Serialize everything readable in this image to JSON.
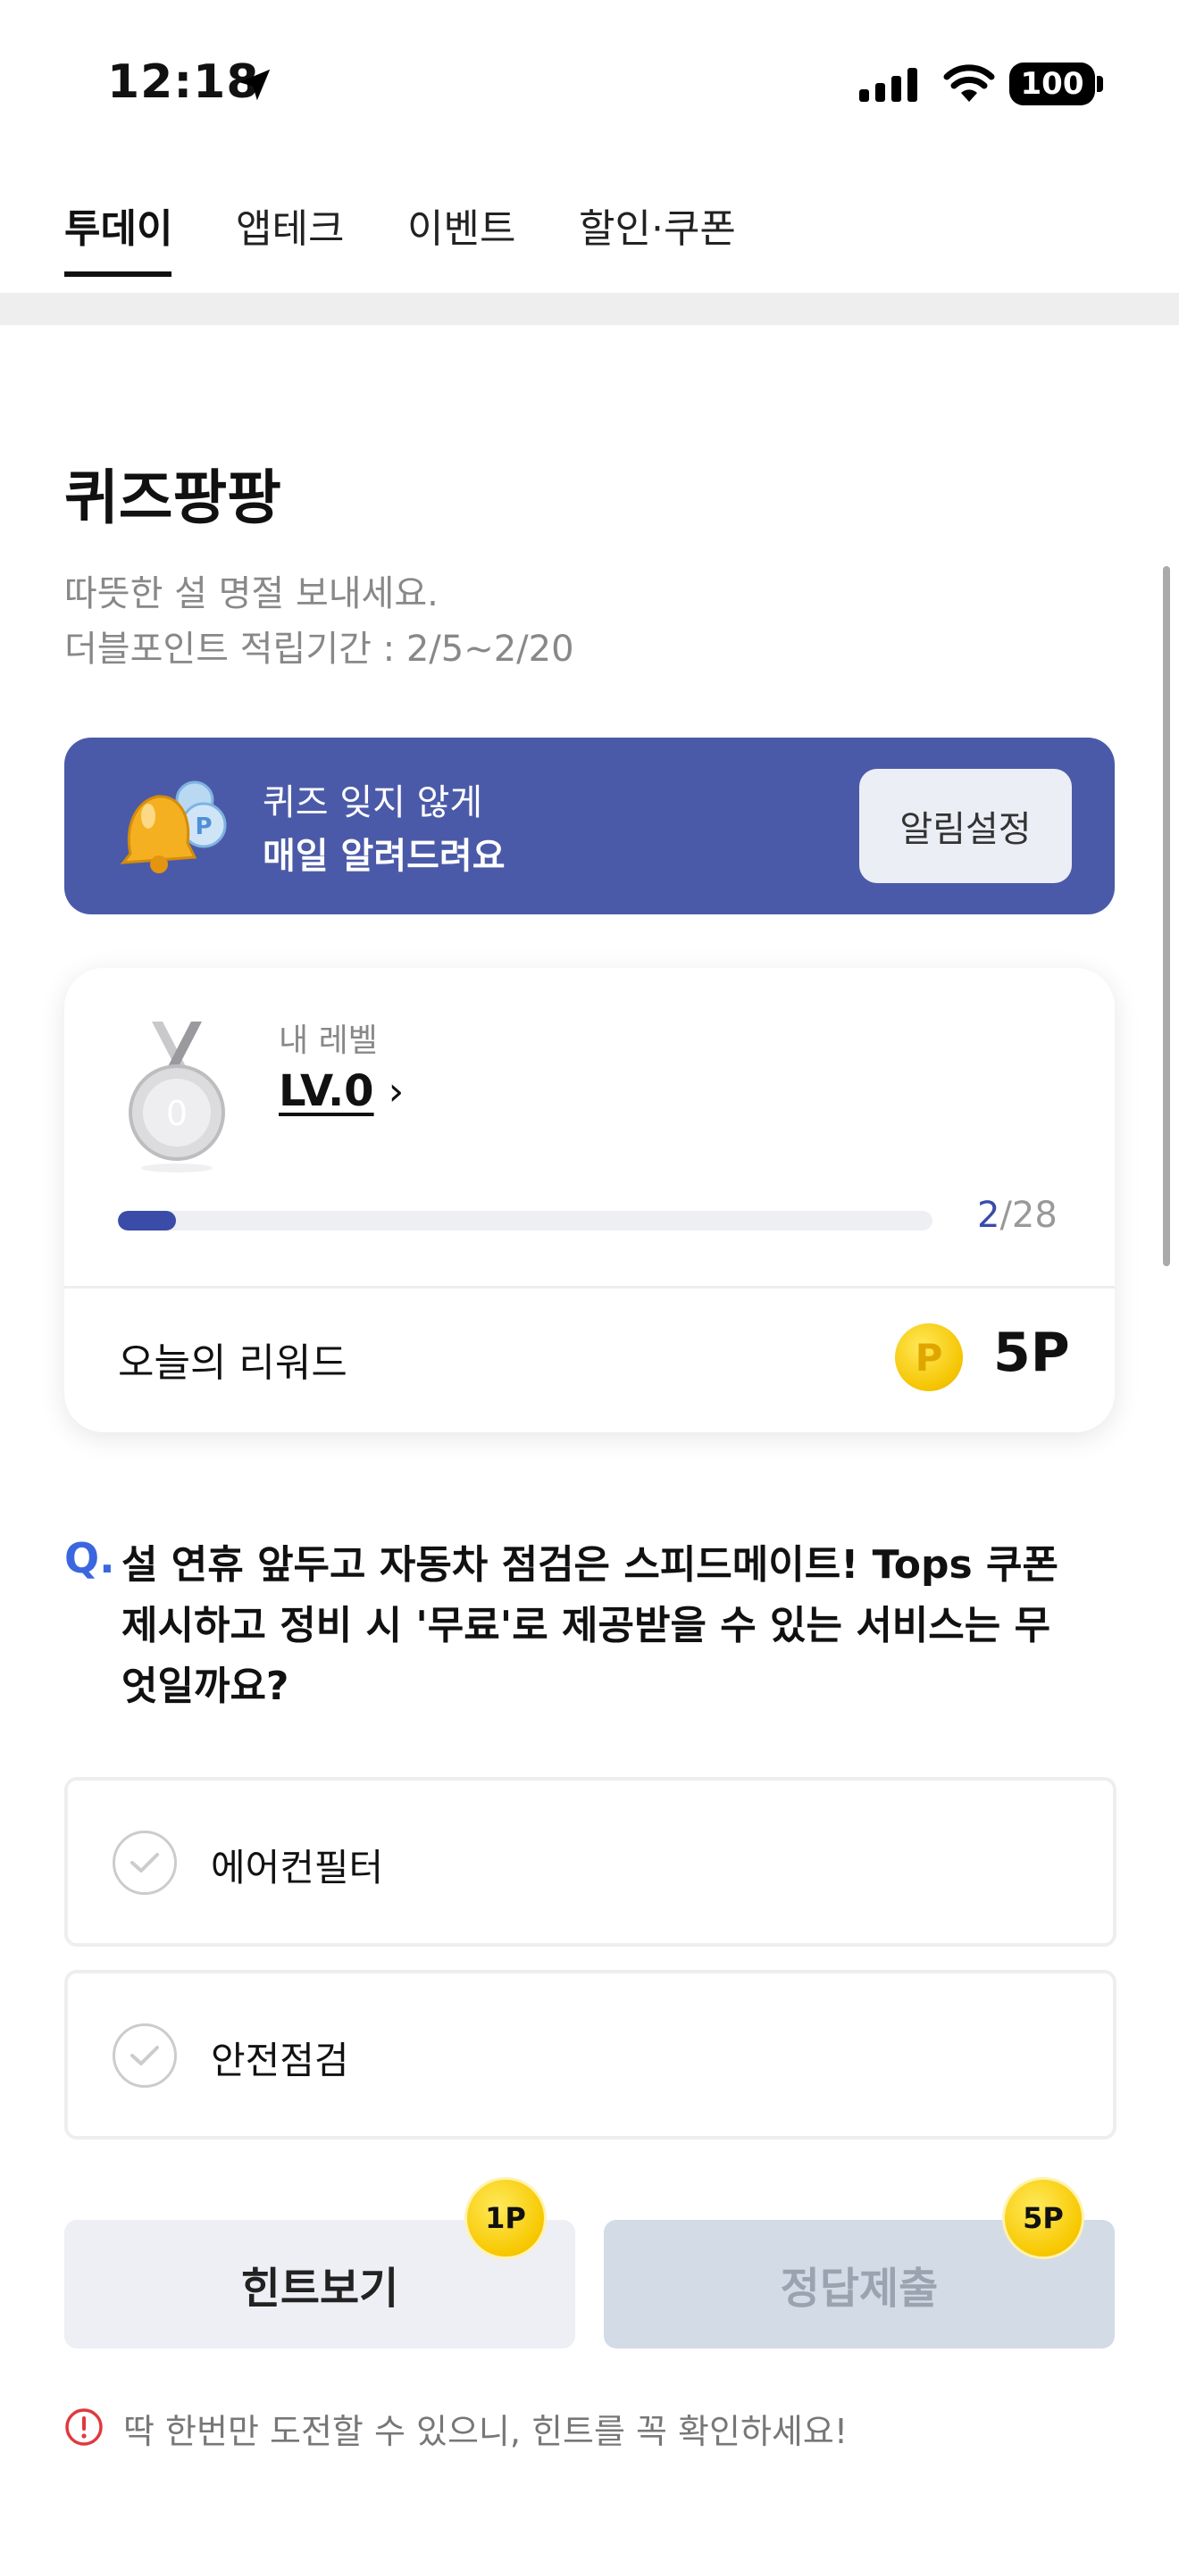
{
  "status_bar": {
    "time": "12:18",
    "battery": "100"
  },
  "tabs": [
    {
      "label": "투데이",
      "active": true
    },
    {
      "label": "앱테크",
      "active": false
    },
    {
      "label": "이벤트",
      "active": false
    },
    {
      "label": "할인·쿠폰",
      "active": false
    }
  ],
  "quiz": {
    "title": "퀴즈팡팡",
    "subtitle_lines": [
      "따뜻한 설 명절 보내세요.",
      "더블포인트 적립기간 : 2/5~2/20"
    ]
  },
  "banner": {
    "line1": "퀴즈 잊지 않게",
    "line2": "매일 알려드려요",
    "button": "알림설정"
  },
  "level_card": {
    "caption": "내 레벨",
    "level": "LV.0",
    "medal_number": "0",
    "progress_current": "2",
    "progress_total": "/28",
    "progress_fraction": 0.0714,
    "reward_label": "오늘의 리워드",
    "coin_symbol": "P",
    "reward_value": "5P"
  },
  "question": {
    "prefix": "Q.",
    "lines": [
      "설 연휴 앞두고 자동차 점검은 스피드메이트! Tops 쿠폰",
      "제시하고 정비 시 '무료'로 제공받을 수 있는 서비스는 무",
      "엇일까요?"
    ]
  },
  "options": [
    "에어컨필터",
    "안전점검"
  ],
  "actions": {
    "hint_label": "힌트보기",
    "hint_badge": "1P",
    "submit_label": "정답제출",
    "submit_badge": "5P"
  },
  "warning": "딱 한번만 도전할 수 있으니, 힌트를 꼭 확인하세요!",
  "colors": {
    "accent": "#3a4ca8",
    "banner": "#4b5aa8",
    "question_mark": "#3b66e0",
    "coin": "#f5c400",
    "warning": "#e0393e"
  }
}
